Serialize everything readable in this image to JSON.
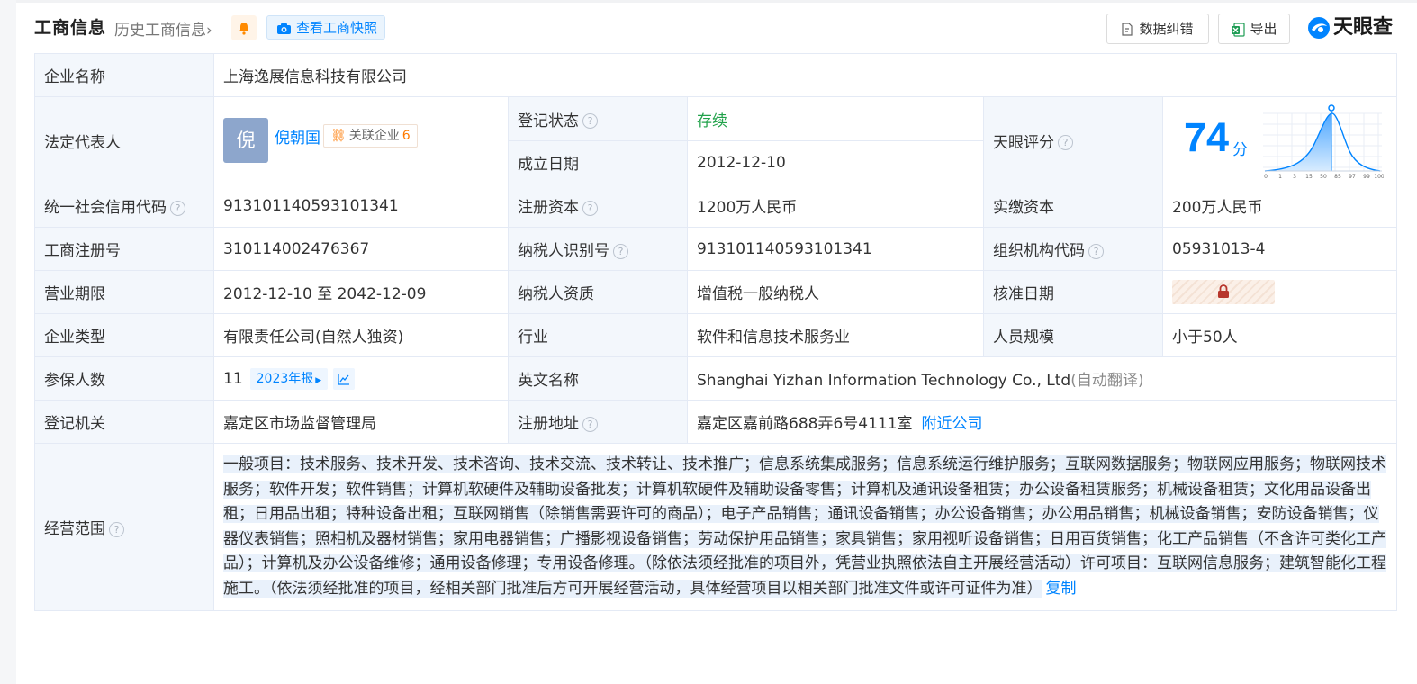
{
  "header": {
    "title": "工商信息",
    "history_link": "历史工商信息",
    "snapshot_button": "查看工商快照",
    "error_button": "数据纠错",
    "export_button": "导出",
    "brand": "天眼查"
  },
  "company": {
    "name_label": "企业名称",
    "name": "上海逸展信息科技有限公司",
    "legal_label": "法定代表人",
    "legal_avatar": "倪",
    "legal_name": "倪朝国",
    "related_label": "关联企业",
    "related_count": "6",
    "reg_status_label": "登记状态",
    "reg_status": "存续",
    "found_date_label": "成立日期",
    "found_date": "2012-12-10",
    "score_label": "天眼评分",
    "score": "74",
    "score_unit": "分",
    "score_axis": [
      "0",
      "1",
      "3",
      "15",
      "50",
      "85",
      "97",
      "99",
      "100"
    ],
    "credit_code_label": "统一社会信用代码",
    "credit_code": "913101140593101341",
    "reg_capital_label": "注册资本",
    "reg_capital": "1200万人民币",
    "paid_capital_label": "实缴资本",
    "paid_capital": "200万人民币",
    "reg_no_label": "工商注册号",
    "reg_no": "310114002476367",
    "taxpayer_id_label": "纳税人识别号",
    "taxpayer_id": "913101140593101341",
    "org_code_label": "组织机构代码",
    "org_code": "05931013-4",
    "term_label": "营业期限",
    "term": "2012-12-10 至 2042-12-09",
    "taxpayer_qual_label": "纳税人资质",
    "taxpayer_qual": "增值税一般纳税人",
    "approve_date_label": "核准日期",
    "type_label": "企业类型",
    "type": "有限责任公司(自然人独资)",
    "industry_label": "行业",
    "industry": "软件和信息技术服务业",
    "staff_label": "人员规模",
    "staff": "小于50人",
    "insured_label": "参保人数",
    "insured": "11",
    "insured_report": "2023年报",
    "english_name_label": "英文名称",
    "english_name": "Shanghai Yizhan Information Technology Co., Ltd",
    "english_note": "(自动翻译)",
    "authority_label": "登记机关",
    "authority": "嘉定区市场监督管理局",
    "address_label": "注册地址",
    "address": "嘉定区嘉前路688弄6号4111室",
    "nearby_link": "附近公司",
    "scope_label": "经营范围",
    "scope": "一般项目：技术服务、技术开发、技术咨询、技术交流、技术转让、技术推广；信息系统集成服务；信息系统运行维护服务；互联网数据服务；物联网应用服务；物联网技术服务；软件开发；软件销售；计算机软硬件及辅助设备批发；计算机软硬件及辅助设备零售；计算机及通讯设备租赁；办公设备租赁服务；机械设备租赁；文化用品设备出租；日用品出租；特种设备出租；互联网销售（除销售需要许可的商品）；电子产品销售；通讯设备销售；办公设备销售；办公用品销售；机械设备销售；安防设备销售；仪器仪表销售；照相机及器材销售；家用电器销售；广播影视设备销售；劳动保护用品销售；家具销售；家用视听设备销售；日用百货销售；化工产品销售（不含许可类化工产品）；计算机及办公设备维修；通用设备修理；专用设备修理。（除依法须经批准的项目外，凭营业执照依法自主开展经营活动）许可项目：互联网信息服务；建筑智能化工程施工。（依法须经批准的项目，经相关部门批准后方可开展经营活动，具体经营项目以相关部门批准文件或许可证件为准）",
    "copy_link": "复制"
  },
  "colors": {
    "accent": "#0084ff",
    "status_green": "#22a24b",
    "label_bg": "#f3f7fc",
    "border": "#e4eaf5"
  }
}
